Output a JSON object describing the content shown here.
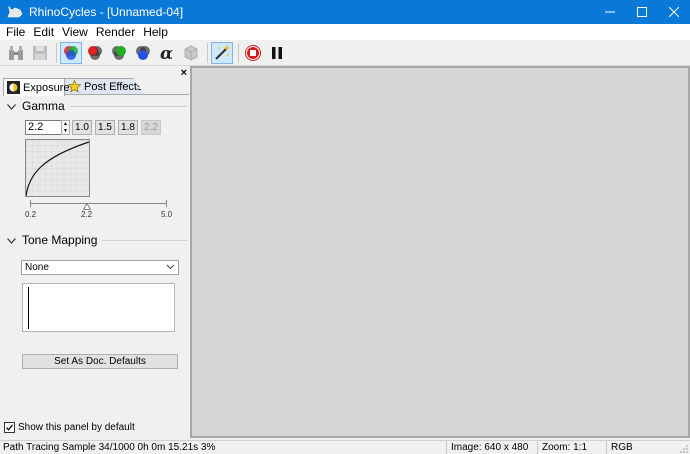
{
  "window": {
    "title": "RhinoCycles - [Unnamed-04]",
    "accent": "#0a78d7"
  },
  "menu": [
    "File",
    "Edit",
    "View",
    "Render",
    "Help"
  ],
  "toolbar": {
    "icons": [
      "binoculars-icon",
      "save-icon",
      "rgb-channels-icon",
      "red-channel-icon",
      "green-channel-icon",
      "blue-channel-icon",
      "alpha-channel-icon",
      "3d-object-icon",
      "magic-wand-icon",
      "stop-icon",
      "pause-icon"
    ]
  },
  "panel": {
    "close": "×",
    "tabs": [
      "Exposure",
      "Post Effects"
    ],
    "gamma": {
      "header": "Gamma",
      "value": "2.2",
      "presets": [
        "1.0",
        "1.5",
        "1.8",
        "2.2"
      ],
      "slider": {
        "min": "0.2",
        "mid": "2.2",
        "max": "5.0",
        "value": 2.2
      }
    },
    "tone_mapping": {
      "header": "Tone Mapping",
      "selected": "None"
    },
    "defaults_button": "Set As Doc. Defaults",
    "show_default_label": "Show this panel by default",
    "show_default_checked": true
  },
  "status": {
    "progress": "Path Tracing Sample 34/1000 0h 0m 15.21s 3%",
    "image": "Image: 640 x 480",
    "zoom": "Zoom: 1:1",
    "channel": "RGB"
  }
}
